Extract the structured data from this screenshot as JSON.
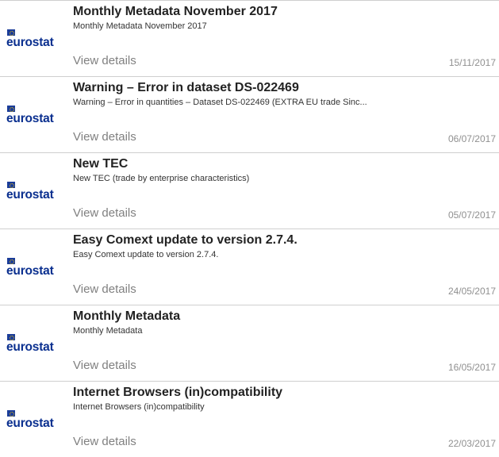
{
  "items": [
    {
      "logo": "eurostat",
      "title": "Monthly Metadata November 2017",
      "description": "Monthly Metadata November 2017",
      "view_label": "View details",
      "date": "15/11/2017"
    },
    {
      "logo": "eurostat",
      "title": "Warning – Error in dataset DS-022469",
      "description": "Warning – Error in quantities – Dataset DS-022469 (EXTRA EU trade Sinc...",
      "view_label": "View details",
      "date": "06/07/2017"
    },
    {
      "logo": "eurostat",
      "title": "New TEC",
      "description": "New TEC (trade by enterprise characteristics)",
      "view_label": "View details",
      "date": "05/07/2017"
    },
    {
      "logo": "eurostat",
      "title": "Easy Comext update to version 2.7.4.",
      "description": "Easy Comext update to version 2.7.4.",
      "view_label": "View details",
      "date": "24/05/2017"
    },
    {
      "logo": "eurostat",
      "title": "Monthly Metadata",
      "description": "Monthly Metadata",
      "view_label": "View details",
      "date": "16/05/2017"
    },
    {
      "logo": "eurostat",
      "title": "Internet Browsers (in)compatibility",
      "description": "Internet Browsers (in)compatibility",
      "view_label": "View details",
      "date": "22/03/2017"
    }
  ]
}
